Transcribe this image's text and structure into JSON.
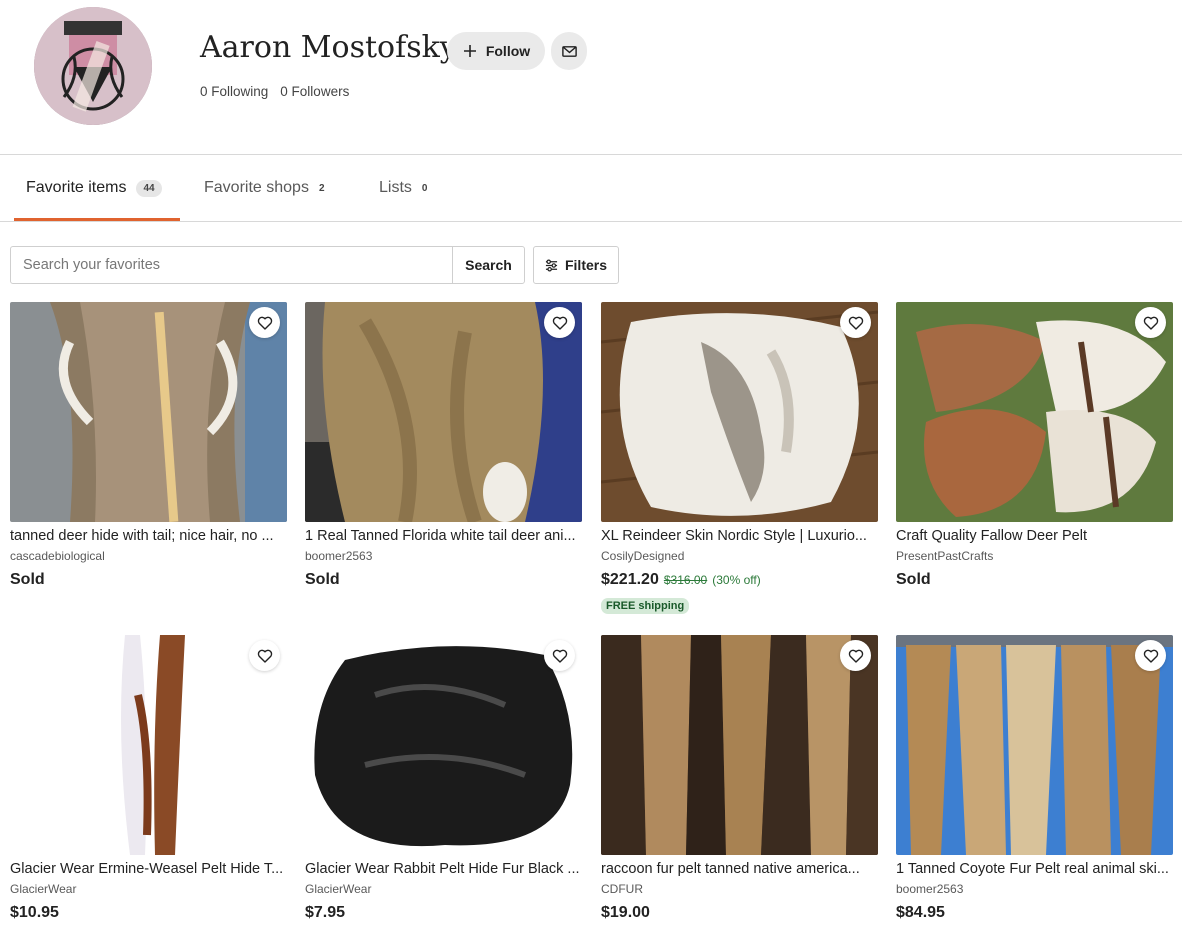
{
  "profile": {
    "name": "Aaron Mostofsky",
    "follow_label": "Follow",
    "following": "0 Following",
    "followers": "0 Followers"
  },
  "tabs": [
    {
      "label": "Favorite items",
      "count": "44"
    },
    {
      "label": "Favorite shops",
      "count": "2"
    },
    {
      "label": "Lists",
      "count": "0"
    }
  ],
  "search": {
    "placeholder": "Search your favorites",
    "value": "",
    "button_label": "Search",
    "filters_label": "Filters"
  },
  "items": [
    {
      "title": "tanned deer hide with tail; nice hair, no ...",
      "shop": "cascadebiological",
      "status": "Sold"
    },
    {
      "title": "1 Real Tanned Florida white tail deer ani...",
      "shop": "boomer2563",
      "status": "Sold"
    },
    {
      "title": "XL Reindeer Skin Nordic Style | Luxurio...",
      "shop": "CosilyDesigned",
      "price": "$221.20",
      "original_price": "$316.00",
      "discount": "(30% off)",
      "badge": "FREE shipping"
    },
    {
      "title": "Craft Quality Fallow Deer Pelt",
      "shop": "PresentPastCrafts",
      "status": "Sold"
    },
    {
      "title": "Glacier Wear Ermine-Weasel Pelt Hide T...",
      "shop": "GlacierWear",
      "price": "$10.95"
    },
    {
      "title": "Glacier Wear Rabbit Pelt Hide Fur Black ...",
      "shop": "GlacierWear",
      "price": "$7.95"
    },
    {
      "title": "raccoon fur pelt tanned native america...",
      "shop": "CDFUR",
      "price": "$19.00"
    },
    {
      "title": "1 Tanned Coyote Fur Pelt real animal ski...",
      "shop": "boomer2563",
      "price": "$84.95"
    }
  ],
  "colors": {
    "accent": "#e0632f",
    "badge_bg": "#d4e9d7",
    "discount": "#2c7a3a"
  },
  "icons": {
    "follow": "plus-icon",
    "message": "envelope-icon",
    "filters": "sliders-icon",
    "favorite": "heart-outline-icon"
  }
}
